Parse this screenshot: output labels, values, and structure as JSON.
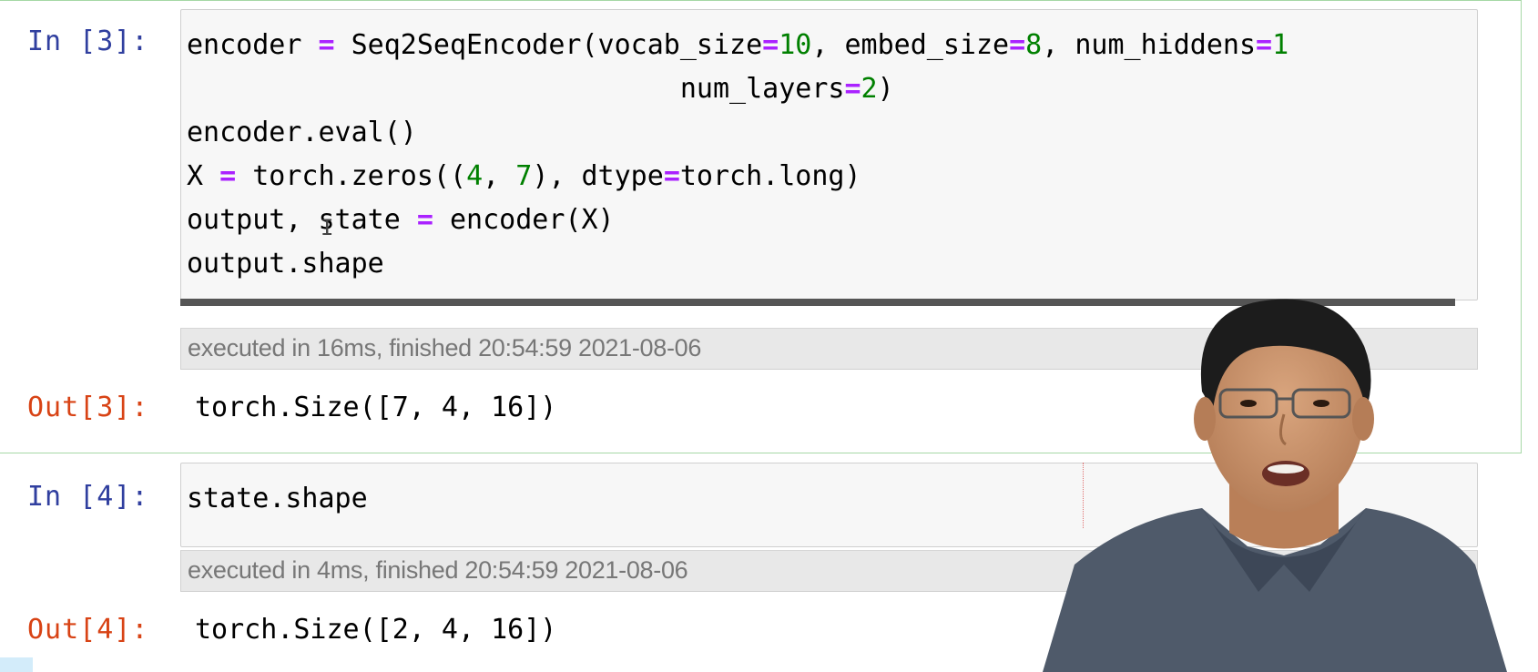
{
  "cells": [
    {
      "in_prompt": "In [3]:",
      "code_lines": [
        [
          [
            "t",
            "encoder "
          ],
          [
            "o",
            "="
          ],
          [
            "t",
            " Seq2SeqEncoder(vocab_size"
          ],
          [
            "o",
            "="
          ],
          [
            "n",
            "10"
          ],
          [
            "t",
            ", embed_size"
          ],
          [
            "o",
            "="
          ],
          [
            "n",
            "8"
          ],
          [
            "t",
            ", num_hiddens"
          ],
          [
            "o",
            "="
          ],
          [
            "n",
            "1"
          ]
        ],
        [
          [
            "t",
            "                              num_layers"
          ],
          [
            "o",
            "="
          ],
          [
            "n",
            "2"
          ],
          [
            "t",
            ")"
          ]
        ],
        [
          [
            "t",
            "encoder.eval()"
          ]
        ],
        [
          [
            "t",
            "X "
          ],
          [
            "o",
            "="
          ],
          [
            "t",
            " torch.zeros(("
          ],
          [
            "n",
            "4"
          ],
          [
            "t",
            ", "
          ],
          [
            "n",
            "7"
          ],
          [
            "t",
            "), dtype"
          ],
          [
            "o",
            "="
          ],
          [
            "t",
            "torch.long)"
          ]
        ],
        [
          [
            "t",
            "output, state "
          ],
          [
            "o",
            "="
          ],
          [
            "t",
            " encoder(X)"
          ]
        ],
        [
          [
            "t",
            "output.shape"
          ]
        ]
      ],
      "exec_info": "executed in 16ms, finished 20:54:59 2021-08-06",
      "out_prompt": "Out[3]:",
      "output": "torch.Size([7, 4, 16])"
    },
    {
      "in_prompt": "In [4]:",
      "code_lines": [
        [
          [
            "t",
            "state.shape"
          ]
        ]
      ],
      "exec_info": "executed in 4ms, finished 20:54:59 2021-08-06",
      "out_prompt": "Out[4]:",
      "output": "torch.Size([2, 4, 16])"
    }
  ],
  "colors": {
    "prompt_in": "#303f9f",
    "prompt_out": "#d84315",
    "operator": "#aa22ff",
    "number": "#008000",
    "selected_border": "#a6d8a6"
  },
  "overlay": {
    "type": "presenter-video",
    "icon": "person-icon"
  }
}
